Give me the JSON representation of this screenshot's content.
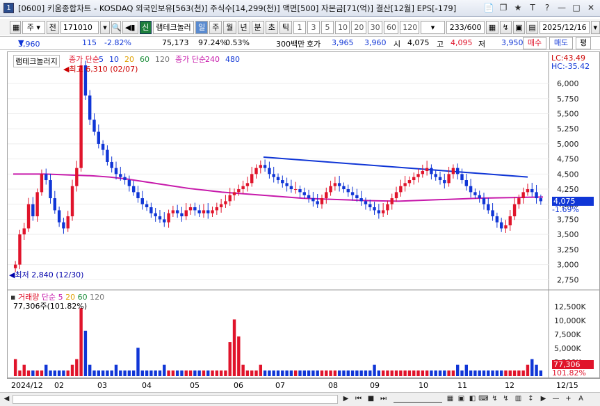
{
  "window": {
    "number": "1",
    "title": "[0600] 키움종합차트 - KOSDAQ 외국인보유[563(천)] 주식수[14,299(천)] 액면[500] 자본금[71(억)] 결산[12월] EPS[-179]",
    "buttons": [
      "📄",
      "❐",
      "★",
      "T",
      "?",
      "—",
      "□",
      "✕"
    ]
  },
  "toolbar": {
    "period_select": "주",
    "prev_label": "전",
    "code": "171010",
    "sound_icon": "◀▮",
    "market_badge": "신",
    "stock_name": "램테크놀러",
    "periods": [
      "일",
      "주",
      "월",
      "년",
      "분",
      "초",
      "틱"
    ],
    "selected_period": "일",
    "nums": [
      "1",
      "3",
      "5",
      "10",
      "20",
      "30",
      "60",
      "120"
    ],
    "count": "233",
    "total": "/600",
    "date": "2025/12/16"
  },
  "quote": {
    "price": "3,960",
    "change": "115",
    "change_pct": "-2.82%",
    "volume": "75,173",
    "vol_ratio": "97.24%",
    "turnover": "0.53%",
    "unit": "300백만",
    "ask_label": "호가",
    "ask": "3,965",
    "bid": "3,960",
    "open_label": "시",
    "open": "4,075",
    "high_label": "고",
    "high": "4,095",
    "low_label": "저",
    "low": "3,950",
    "buy": "매수",
    "sell": "매도",
    "eval": "평"
  },
  "chart_data": {
    "type": "candlestick",
    "title": "램테크놀러지",
    "legend": [
      {
        "label": "종가 단순",
        "color": "#e0142b"
      },
      {
        "label": "5",
        "color": "#1036d6"
      },
      {
        "label": "10",
        "color": "#1036d6"
      },
      {
        "label": "20",
        "color": "#e0a000"
      },
      {
        "label": "60",
        "color": "#1e8f3c"
      },
      {
        "label": "120",
        "color": "#777777"
      },
      {
        "label": "종가 단순",
        "color": "#c71aab"
      },
      {
        "label": "240",
        "color": "#c71aab"
      },
      {
        "label": "480",
        "color": "#1036d6"
      }
    ],
    "annotations": {
      "high": "최고 6,310 (02/07)",
      "low": "최저 2,840 (12/30)"
    },
    "y_ticks": [
      "6,000",
      "5,750",
      "5,500",
      "5,250",
      "5,000",
      "4,750",
      "4,500",
      "4,250",
      "4,000",
      "3,750",
      "3,500",
      "3,250",
      "3,000",
      "2,750"
    ],
    "ylim": [
      2650,
      6450
    ],
    "lc": "LC:43.49",
    "hc": "HC:-35.42",
    "last_price": "4,075",
    "last_pct": "-1.69%",
    "x_labels": [
      "2024/12",
      "02",
      "03",
      "04",
      "05",
      "06",
      "07",
      "08",
      "09",
      "10",
      "11",
      "12",
      "12/15"
    ],
    "close_series": [
      3000,
      3500,
      3600,
      4000,
      3800,
      4200,
      4500,
      4400,
      4100,
      3900,
      3700,
      3600,
      3800,
      4300,
      4600,
      6300,
      5800,
      5400,
      5200,
      5000,
      4900,
      4700,
      4600,
      4500,
      4450,
      4400,
      4300,
      4200,
      4100,
      4000,
      3950,
      3850,
      3800,
      3750,
      3700,
      3850,
      3900,
      3850,
      3800,
      3900,
      3950,
      3900,
      3850,
      3900,
      3850,
      3900,
      3950,
      4000,
      4050,
      4150,
      4200,
      4250,
      4300,
      4350,
      4500,
      4600,
      4650,
      4600,
      4500,
      4450,
      4400,
      4350,
      4300,
      4250,
      4250,
      4200,
      4150,
      4100,
      4050,
      4000,
      4100,
      4200,
      4300,
      4350,
      4300,
      4250,
      4200,
      4150,
      4100,
      4050,
      4000,
      3950,
      3900,
      3850,
      3900,
      4000,
      4100,
      4200,
      4300,
      4350,
      4400,
      4450,
      4500,
      4550,
      4600,
      4500,
      4450,
      4400,
      4350,
      4500,
      4600,
      4500,
      4400,
      4300,
      4200,
      4150,
      4100,
      4000,
      3900,
      3800,
      3700,
      3600,
      3650,
      3800,
      4000,
      4100,
      4200,
      4250,
      4200,
      4100,
      4050
    ],
    "ma240": [
      4500,
      4500,
      4500,
      4490,
      4480,
      4470,
      4450,
      4420,
      4380,
      4340,
      4300,
      4260,
      4230,
      4200,
      4180,
      4160,
      4140,
      4120,
      4100,
      4090,
      4080,
      4070,
      4060,
      4055,
      4050,
      4060,
      4070,
      4080,
      4090,
      4100,
      4105,
      4110,
      4115,
      4120
    ],
    "volume": {
      "label": "거래량",
      "ma_label": "단순",
      "ma": [
        "5",
        "20",
        "60",
        "120"
      ],
      "info": "77,306주(101.82%)",
      "y_ticks": [
        "12,500K",
        "10,000K",
        "7,500K",
        "5,000K",
        "2,500K"
      ],
      "last": "77,306",
      "last_pct": "101.82%",
      "bars": [
        3,
        1,
        2,
        1,
        1,
        1,
        1,
        2,
        1,
        1,
        1,
        1,
        1,
        2,
        3,
        12,
        8,
        2,
        1,
        1,
        1,
        1,
        1,
        2,
        1,
        1,
        1,
        1,
        5,
        1,
        1,
        1,
        1,
        1,
        2,
        1,
        1,
        1,
        1,
        1,
        1,
        1,
        1,
        1,
        1,
        1,
        1,
        1,
        1,
        6,
        10,
        7,
        2,
        1,
        1,
        1,
        2,
        1,
        1,
        1,
        1,
        1,
        1,
        1,
        1,
        1,
        1,
        1,
        1,
        1,
        1,
        1,
        1,
        1,
        1,
        1,
        1,
        1,
        1,
        1,
        1,
        1,
        2,
        1,
        1,
        1,
        1,
        1,
        1,
        1,
        1,
        1,
        1,
        1,
        1,
        1,
        1,
        1,
        1,
        1,
        1,
        2,
        1,
        2,
        1,
        1,
        1,
        1,
        1,
        1,
        1,
        1,
        1,
        1,
        1,
        1,
        1,
        2,
        3,
        2,
        1
      ]
    }
  },
  "datebar": {
    "labels": [
      "2024/12",
      "02",
      "03",
      "04",
      "05",
      "06",
      "07",
      "08",
      "09",
      "10",
      "11",
      "12",
      "12/15"
    ]
  }
}
